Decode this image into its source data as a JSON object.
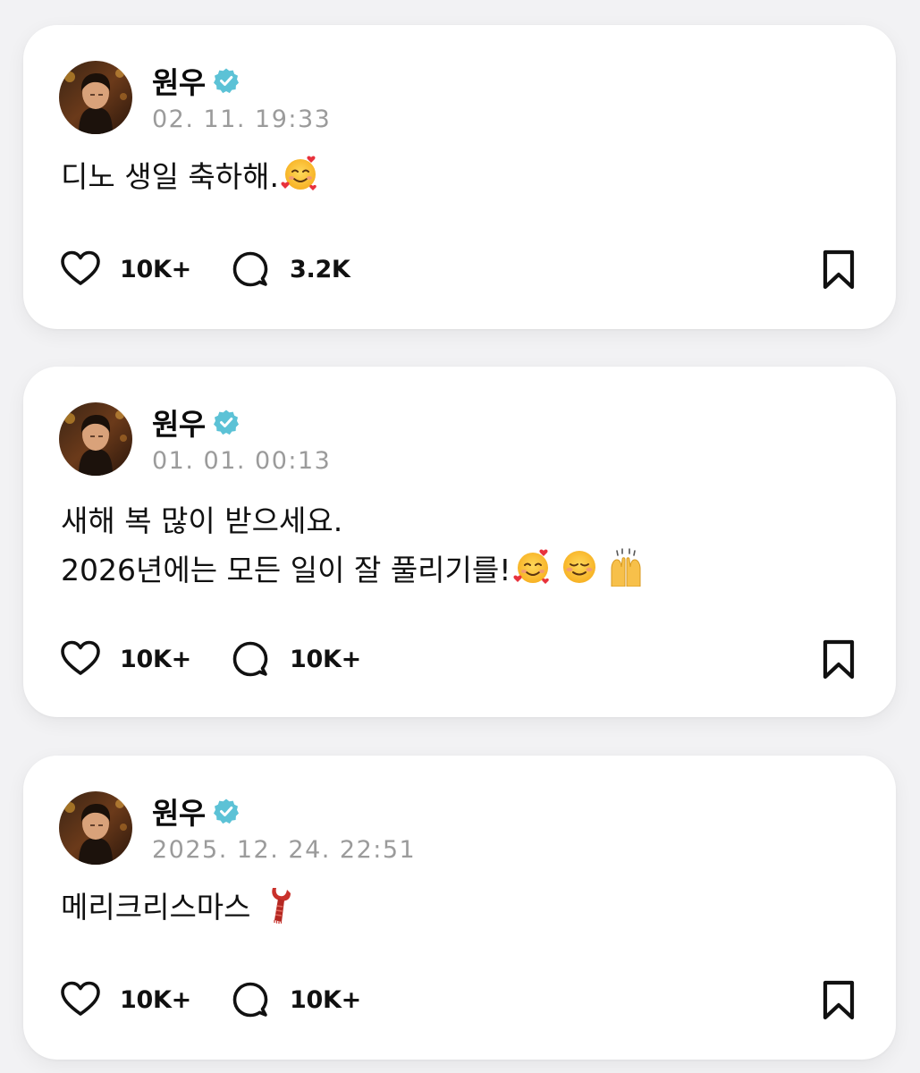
{
  "posts": [
    {
      "author": "원우",
      "verified_icon": "verified-badge-icon",
      "timestamp": "02. 11. 19:33",
      "text_lines": [
        "디노 생일 축하해."
      ],
      "emojis": [
        "smiling-face-with-hearts"
      ],
      "likes": "10K+",
      "comments": "3.2K"
    },
    {
      "author": "원우",
      "verified_icon": "verified-badge-icon",
      "timestamp": "01. 01. 00:13",
      "text_lines": [
        "새해 복 많이 받으세요.",
        "2026년에는 모든 일이 잘 풀리기를!"
      ],
      "emojis": [
        "smiling-face-with-hearts",
        "smiling-face",
        "raising-hands"
      ],
      "likes": "10K+",
      "comments": "10K+"
    },
    {
      "author": "원우",
      "verified_icon": "verified-badge-icon",
      "timestamp": "2025. 12. 24. 22:51",
      "text_lines": [
        "메리크리스마스 "
      ],
      "emojis": [
        "scarf"
      ],
      "likes": "10K+",
      "comments": "10K+"
    }
  ],
  "colors": {
    "page_background": "#f2f2f4",
    "card_background": "#ffffff",
    "verified_badge": "#5cc2d6",
    "timestamp": "#9b9b9b",
    "text": "#111111"
  },
  "icons": {
    "like": "heart-outline-icon",
    "comment": "speech-bubble-icon",
    "bookmark": "bookmark-outline-icon"
  }
}
